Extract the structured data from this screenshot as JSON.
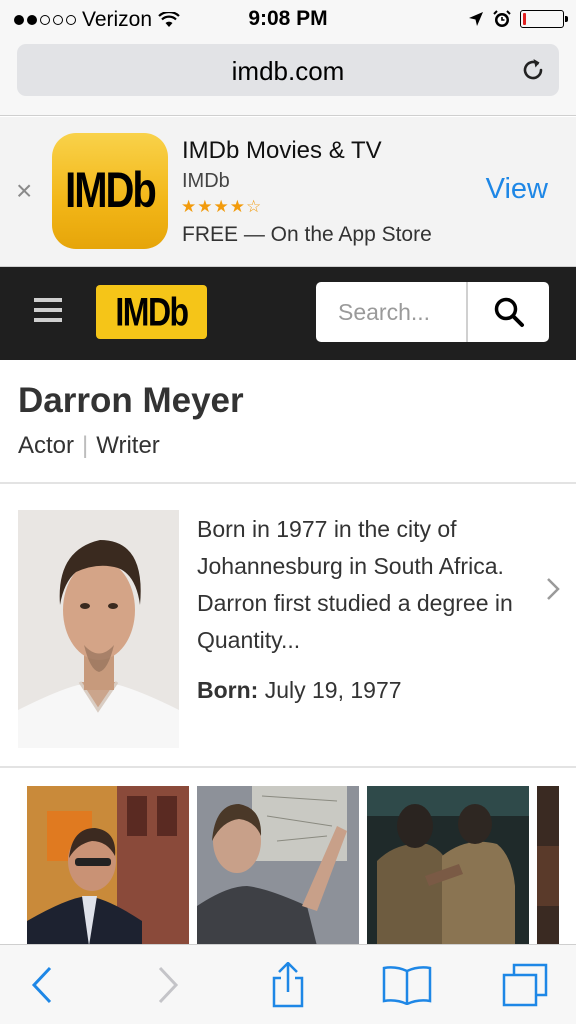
{
  "status_bar": {
    "carrier": "Verizon",
    "time": "9:08 PM",
    "signal_bars_filled": 2,
    "signal_bars_total": 5,
    "battery_level": 0.05,
    "battery_color": "#e02020"
  },
  "browser": {
    "url": "imdb.com",
    "reload_icon": "reload-icon",
    "toolbar_icons": [
      "back-icon",
      "forward-icon",
      "share-icon",
      "bookmarks-icon",
      "tabs-icon"
    ],
    "accent_color": "#1e87e6"
  },
  "app_banner": {
    "icon_text": "IMDb",
    "app_name": "IMDb Movies & TV",
    "developer": "IMDb",
    "rating_stars": 4,
    "rating_max": 5,
    "stars_text": "★★★★☆",
    "price_text": "FREE — On the App Store",
    "view_label": "View",
    "close_label": "×"
  },
  "imdb_header": {
    "logo_text": "IMDb",
    "brand_color": "#f5c518",
    "search_placeholder": "Search...",
    "menu_icon": "hamburger-icon",
    "search_icon": "search-icon"
  },
  "person": {
    "name": "Darron Meyer",
    "roles": [
      "Actor",
      "Writer"
    ],
    "bio": "Born in 1977 in the city of Johannesburg in South Africa. Darron first studied a degree in Quantity...",
    "born_label": "Born:",
    "born_date": "July 19, 1977"
  },
  "photos": [
    "photo-street",
    "photo-whiteboard",
    "photo-soldiers",
    "photo-partial"
  ]
}
